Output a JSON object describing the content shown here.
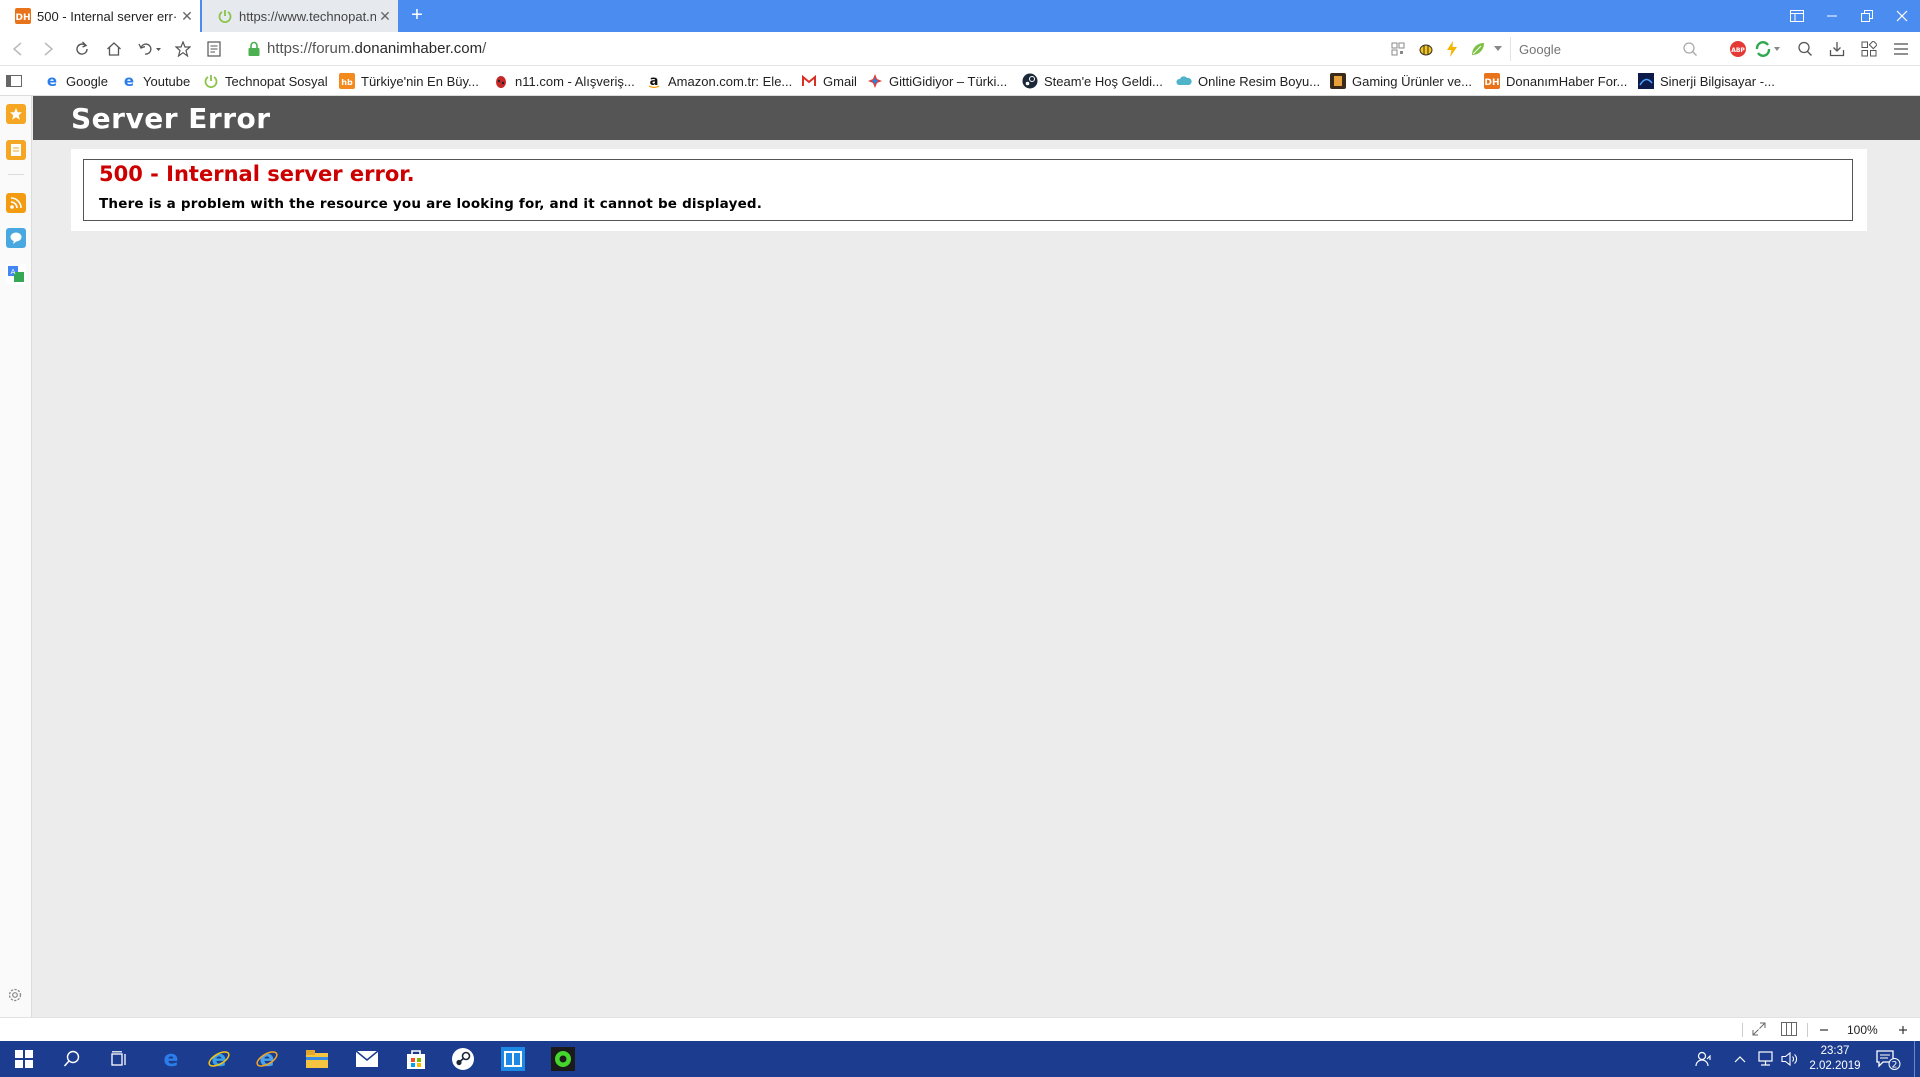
{
  "browser": {
    "tabs": [
      {
        "label": "500 - Internal server err·",
        "favicon": "donanimhaber-dh-icon",
        "active": true
      },
      {
        "label": "https://www.technopat.n·",
        "favicon": "technopat-power-icon",
        "active": false
      }
    ],
    "new_tab_label": "+",
    "address": {
      "prefix": "https://forum.",
      "host": "donanimhaber.com",
      "suffix": "/"
    },
    "search": {
      "placeholder": "Google"
    },
    "bookmarks": [
      {
        "label": "Google",
        "icon": "ie-icon"
      },
      {
        "label": "Youtube",
        "icon": "ie-icon"
      },
      {
        "label": "Technopat Sosyal",
        "icon": "technopat-power-icon"
      },
      {
        "label": "Türkiye'nin En Büy...",
        "icon": "hepsiburada-icon"
      },
      {
        "label": "n11.com - Alışveriş...",
        "icon": "n11-ladybug-icon"
      },
      {
        "label": "Amazon.com.tr: Ele...",
        "icon": "amazon-icon"
      },
      {
        "label": "Gmail",
        "icon": "gmail-icon"
      },
      {
        "label": "GittiGidiyor – Türki...",
        "icon": "gittigidiyor-icon"
      },
      {
        "label": "Steam'e Hoş Geldi...",
        "icon": "steam-icon"
      },
      {
        "label": "Online Resim Boyu...",
        "icon": "cloud-icon"
      },
      {
        "label": "Gaming Ürünler ve...",
        "icon": "gaming-icon"
      },
      {
        "label": "DonanımHaber For...",
        "icon": "donanimhaber-dh-icon"
      },
      {
        "label": "Sinerji Bilgisayar  -...",
        "icon": "sinerji-icon"
      }
    ],
    "zoom": "100%"
  },
  "page": {
    "header_title": "Server Error",
    "error_title": "500 - Internal server error.",
    "error_description": "There is a problem with the resource you are looking for, and it cannot be displayed."
  },
  "taskbar": {
    "time": "23:37",
    "date": "2.02.2019",
    "notification_count": "2"
  },
  "colors": {
    "tabbar": "#4b8cf0",
    "page_header": "#555555",
    "error_title": "#cc0000",
    "taskbar": "#1c3d8f"
  }
}
